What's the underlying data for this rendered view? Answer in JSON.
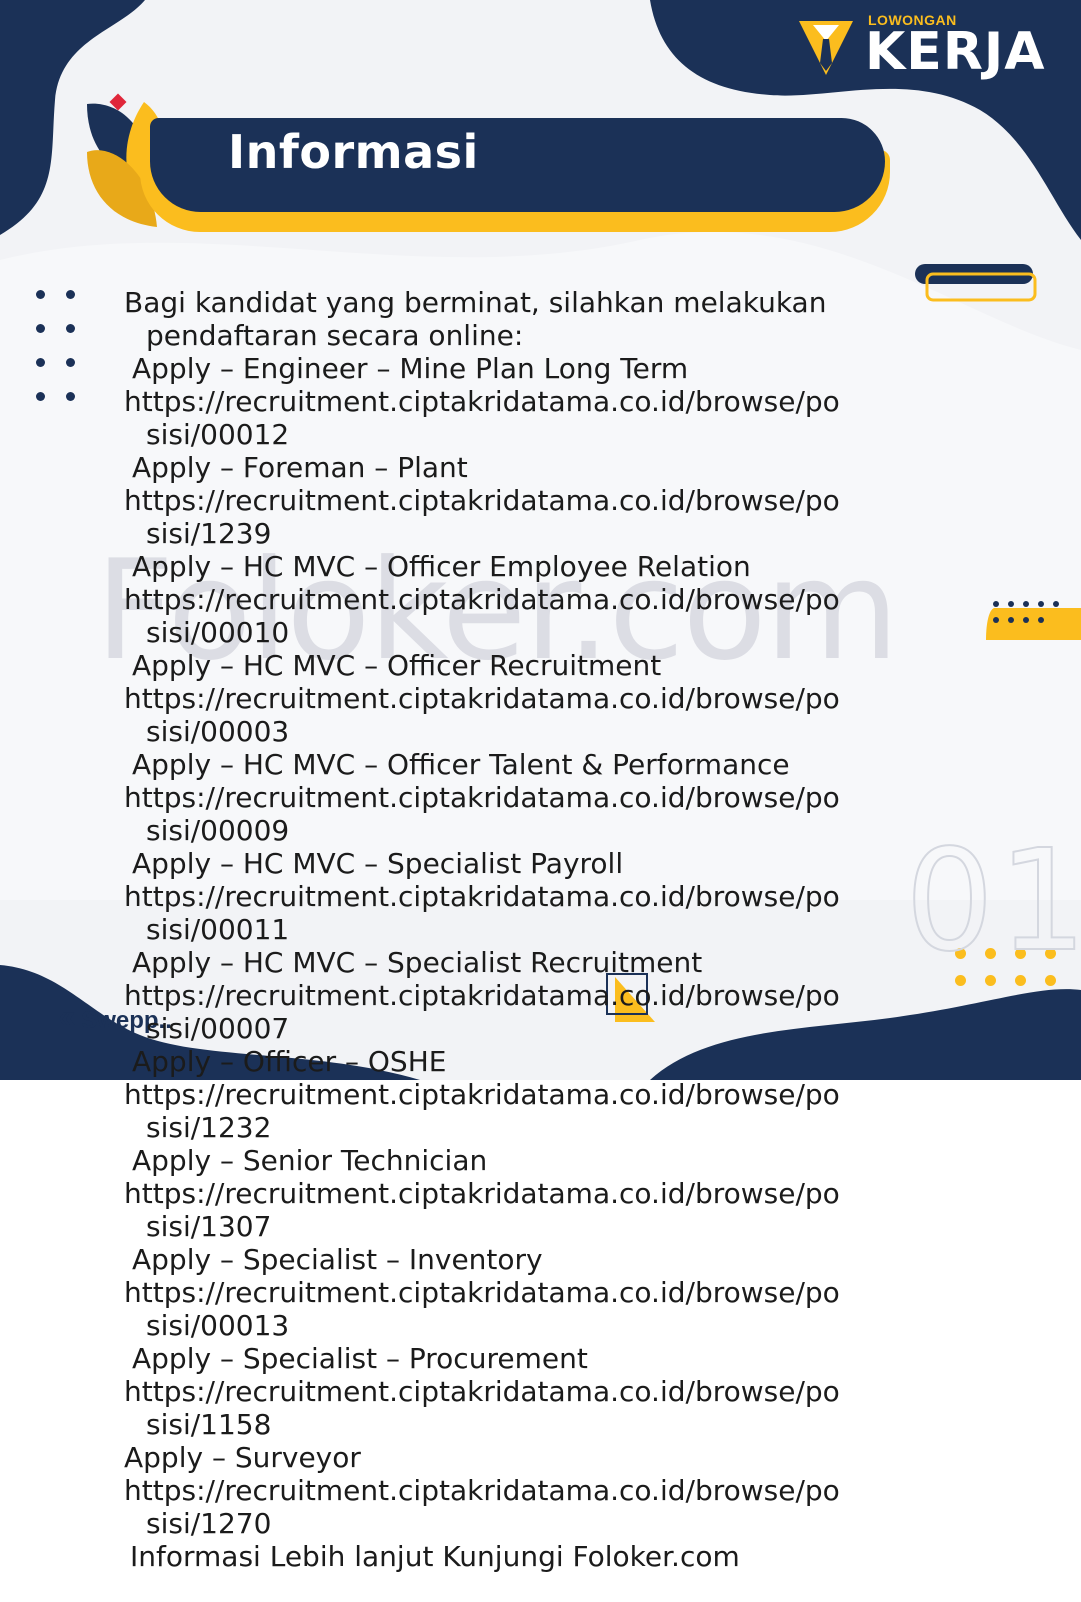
{
  "logo": {
    "small": "LOWONGAN",
    "big": "KERJA",
    "icon": "tie-icon"
  },
  "title": "Informasi",
  "watermark": "Foloker.com",
  "page_number": "01",
  "swipe_label": "Swepp..",
  "intro": [
    "Bagi kandidat yang berminat, silahkan melakukan",
    "pendaftaran secara online:"
  ],
  "jobs": [
    {
      "title": "Apply  – Engineer – Mine Plan Long Term",
      "url1": "https://recruitment.ciptakridatama.co.id/browse/po",
      "url2": "sisi/00012"
    },
    {
      "title": "Apply  – Foreman – Plant",
      "url1": "https://recruitment.ciptakridatama.co.id/browse/po",
      "url2": "sisi/1239"
    },
    {
      "title": "Apply  – HC MVC – Officer Employee Relation",
      "url1": "https://recruitment.ciptakridatama.co.id/browse/po",
      "url2": "sisi/00010"
    },
    {
      "title": "Apply  – HC MVC – Officer Recruitment",
      "url1": "https://recruitment.ciptakridatama.co.id/browse/po",
      "url2": "sisi/00003"
    },
    {
      "title": "Apply  – HC MVC – Officer Talent & Performance",
      "url1": "https://recruitment.ciptakridatama.co.id/browse/po",
      "url2": "sisi/00009"
    },
    {
      "title": "Apply  – HC MVC – Specialist Payroll",
      "url1": "https://recruitment.ciptakridatama.co.id/browse/po",
      "url2": "sisi/00011"
    },
    {
      "title": "Apply  – HC MVC – Specialist Recruitment",
      "url1": "https://recruitment.ciptakridatama.co.id/browse/po",
      "url2": "sisi/00007"
    },
    {
      "title": "Apply  – Officer – OSHE",
      "url1": "https://recruitment.ciptakridatama.co.id/browse/po",
      "url2": "sisi/1232"
    },
    {
      "title": "Apply  – Senior Technician",
      "url1": "https://recruitment.ciptakridatama.co.id/browse/po",
      "url2": "sisi/1307"
    },
    {
      "title": "Apply  – Specialist – Inventory",
      "url1": "https://recruitment.ciptakridatama.co.id/browse/po",
      "url2": "sisi/00013"
    },
    {
      "title": "Apply  – Specialist – Procurement",
      "url1": "https://recruitment.ciptakridatama.co.id/browse/po",
      "url2": "sisi/1158"
    },
    {
      "title": "Apply  – Surveyor",
      "url1": "https://recruitment.ciptakridatama.co.id/browse/po",
      "url2": "sisi/1270"
    }
  ],
  "footer": "Informasi Lebih lanjut Kunjungi Foloker.com",
  "colors": {
    "navy": "#1b3157",
    "yellow": "#fbbd1e",
    "red": "#e0263a"
  }
}
